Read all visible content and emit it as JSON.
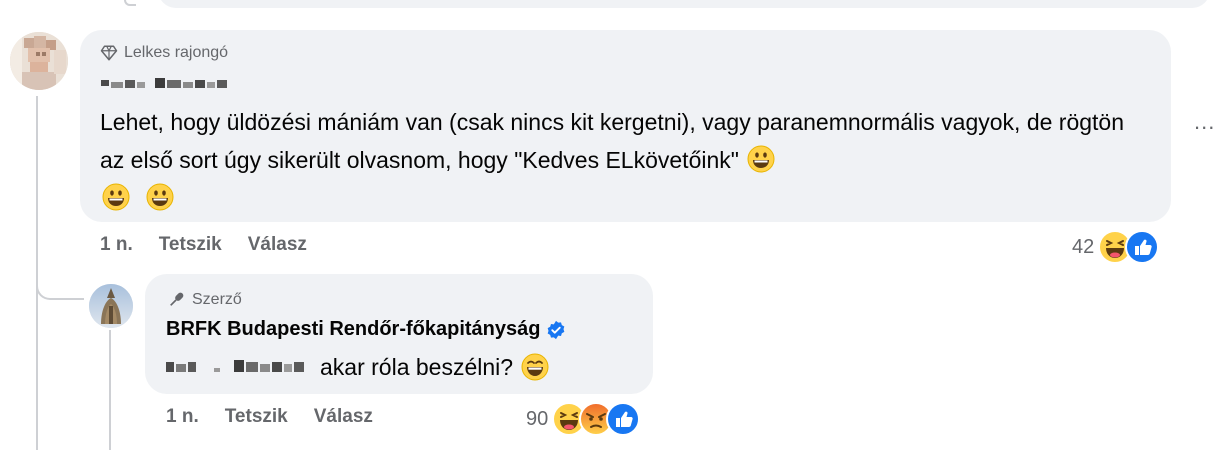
{
  "comments": [
    {
      "badge": "Lelkes rajongó",
      "badge_icon": "diamond-icon",
      "text": "Lehet, hogy üldözési mániám van (csak nincs kit kergetni), vagy paranemnormális vagyok, de rögtön az első sort úgy sikerült olvasnom, hogy \"Kedves ELkövetőink\"",
      "time": "1 n.",
      "like_label": "Tetszik",
      "reply_label": "Válasz",
      "reaction_count": "42",
      "reaction_icons": [
        "laugh-reaction-icon",
        "like-reaction-icon"
      ]
    },
    {
      "badge": "Szerző",
      "badge_icon": "microphone-icon",
      "author": "BRFK Budapesti Rendőr-főkapitányság",
      "verified": true,
      "text": "akar róla beszélni?",
      "time": "1 n.",
      "like_label": "Tetszik",
      "reply_label": "Válasz",
      "reaction_count": "90",
      "reaction_icons": [
        "laugh-reaction-icon",
        "angry-reaction-icon",
        "like-reaction-icon"
      ]
    }
  ],
  "more_label": "...",
  "colors": {
    "bubble": "#f0f2f5",
    "secondary_text": "#65676b",
    "like_blue": "#1877f2",
    "emoji_yellow": "#ffd24a"
  }
}
